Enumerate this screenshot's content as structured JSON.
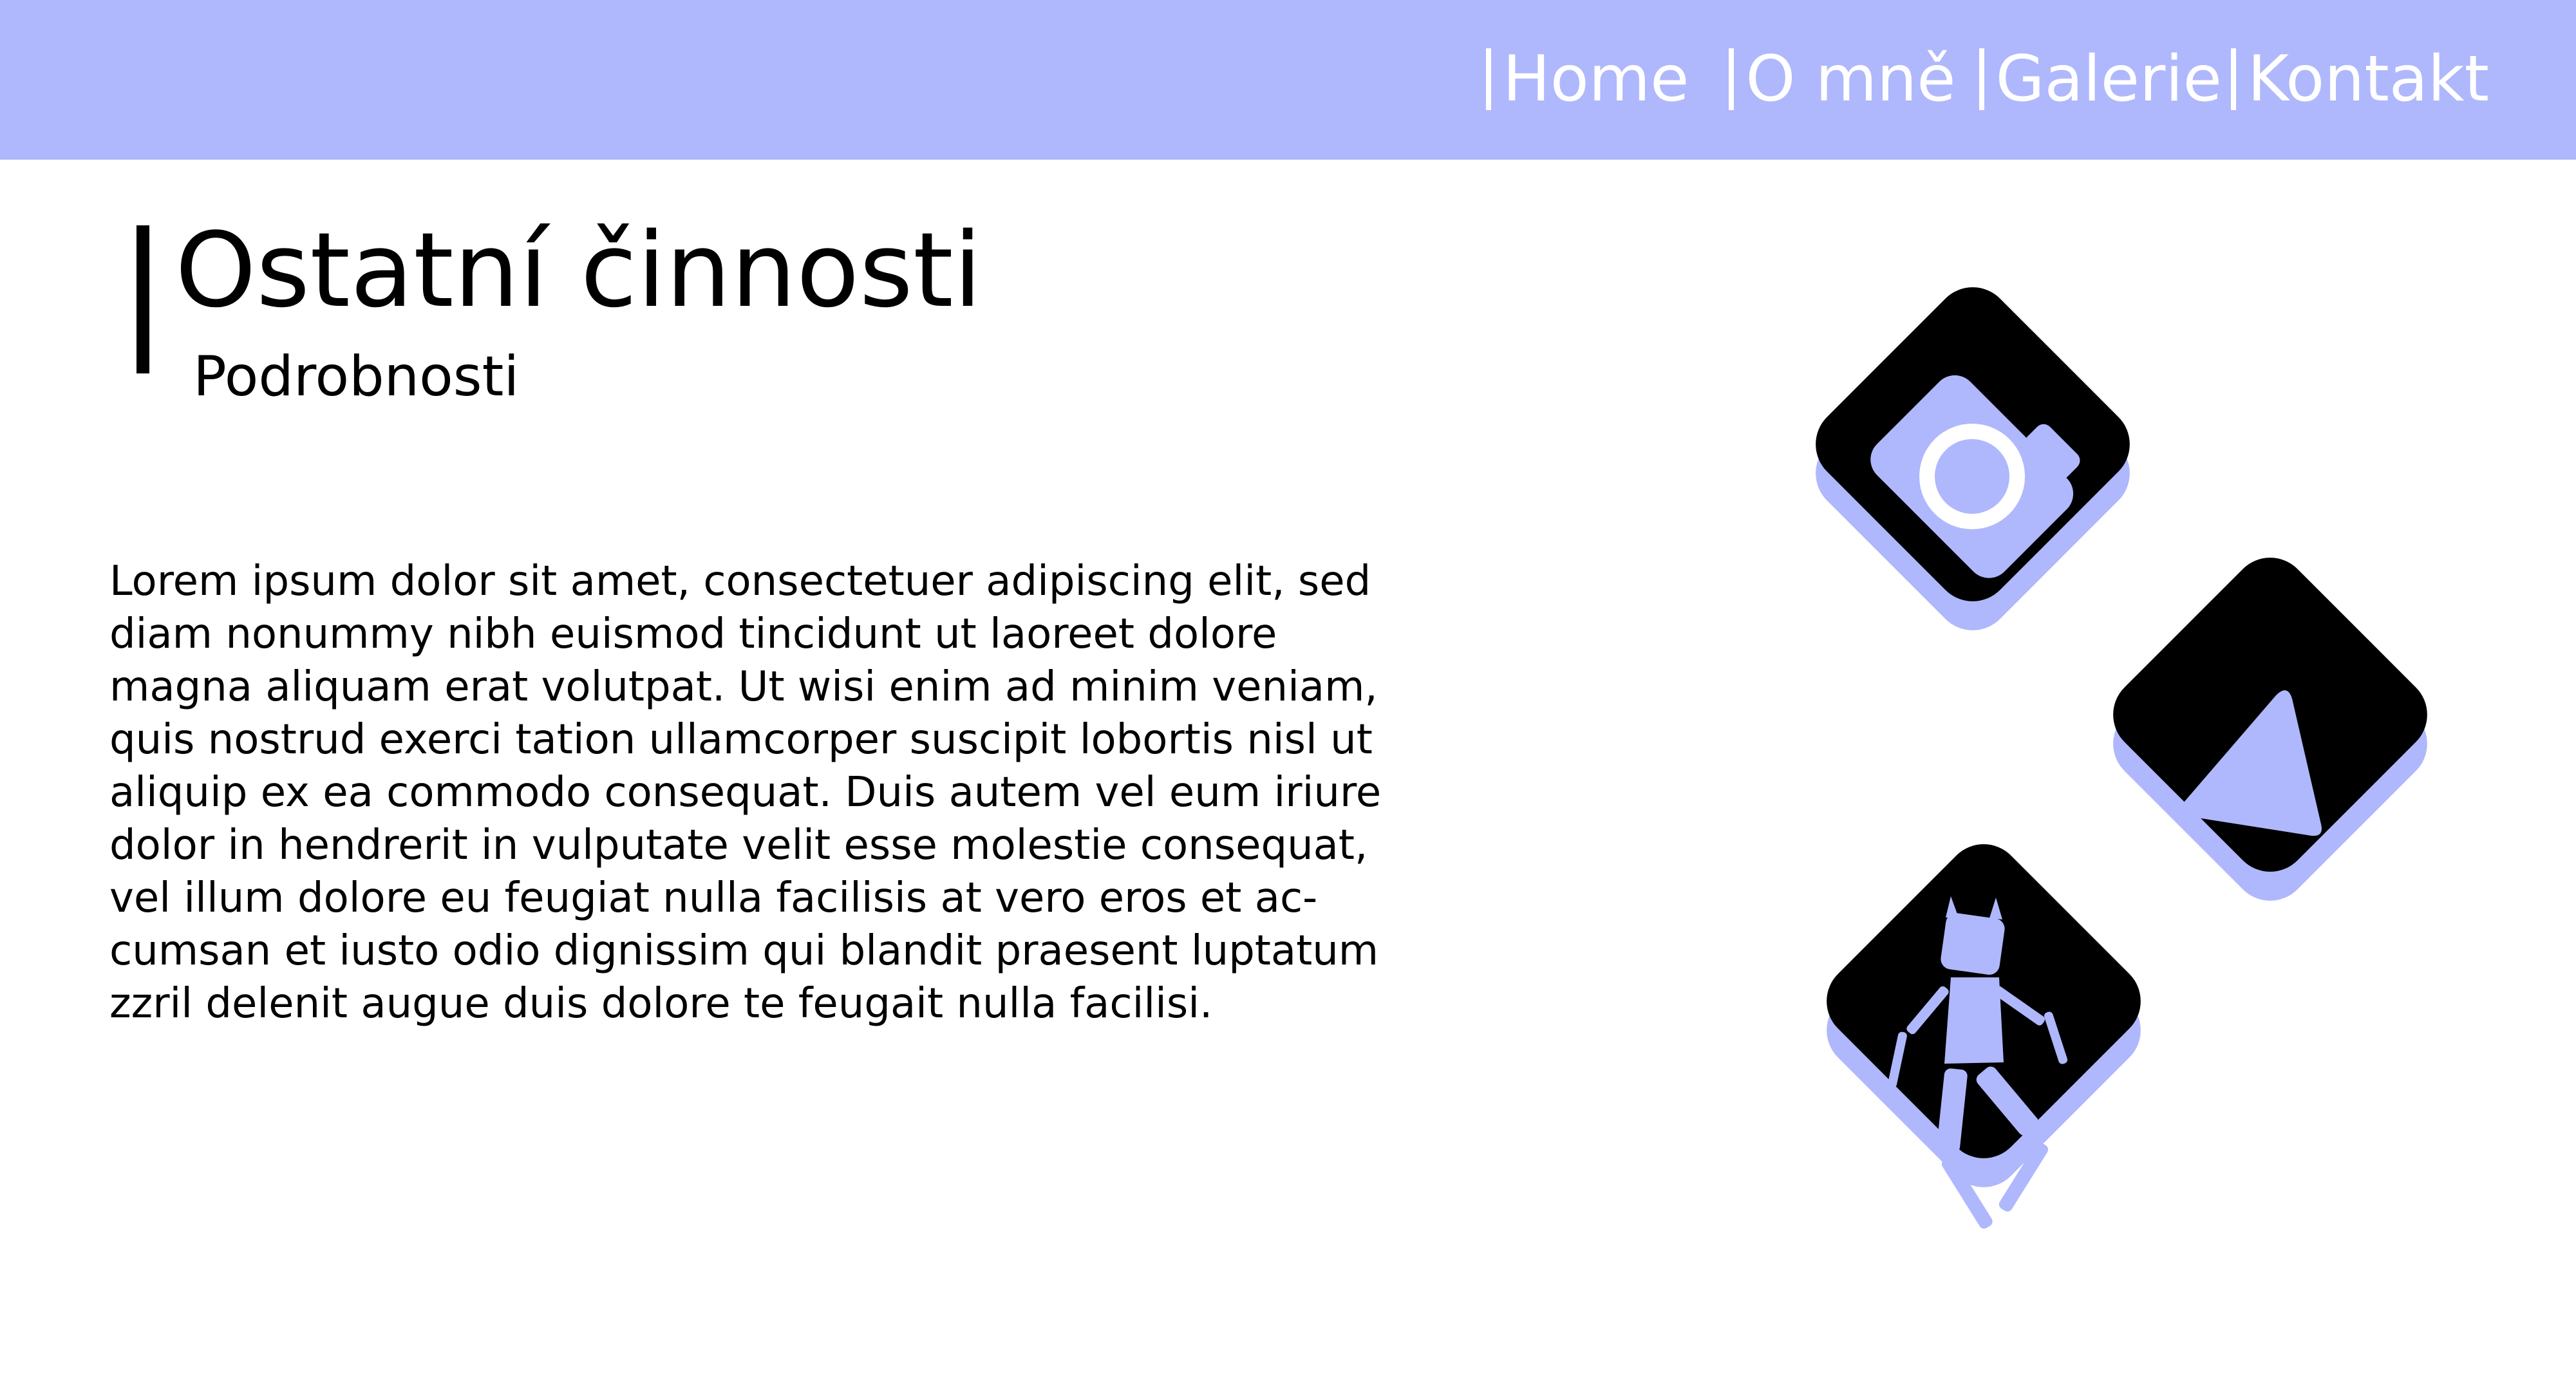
{
  "nav": {
    "items": [
      {
        "label": "Home"
      },
      {
        "label": "O mně"
      },
      {
        "label": "Galerie"
      },
      {
        "label": "Kontakt"
      }
    ]
  },
  "page": {
    "title": "Ostatní činnosti",
    "subtitle": "Podrobnosti",
    "body_lines": [
      "Lorem ipsum dolor sit amet, consectetuer adipiscing elit, sed",
      "diam nonummy nibh euismod tincidunt ut laoreet dolore",
      "magna aliquam erat volutpat. Ut wisi enim ad minim veniam,",
      "quis nostrud exerci tation ullamcorper suscipit lobortis nisl ut",
      "aliquip ex ea commodo consequat. Duis autem vel eum iriure",
      "dolor in hendrerit in vulputate velit esse molestie consequat,",
      "vel illum dolore eu feugiat nulla facilisis at vero eros et ac-",
      "cumsan et iusto odio dignissim qui blandit praesent luptatum",
      "zzril delenit augue duis dolore te feugait nulla facilisi."
    ]
  },
  "tiles": [
    {
      "icon": "camera-icon"
    },
    {
      "icon": "play-icon"
    },
    {
      "icon": "figure-icon"
    }
  ],
  "colors": {
    "accent": "#afb8fc",
    "tile": "#000000",
    "text": "#000000",
    "nav_text": "#ffffff"
  }
}
